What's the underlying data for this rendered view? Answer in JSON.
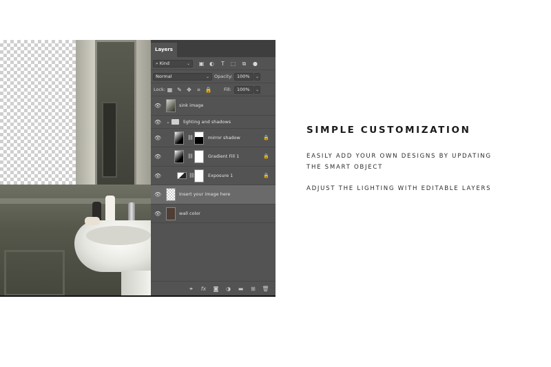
{
  "panel": {
    "tab_label": "Layers",
    "filter": {
      "kind_label": "Kind",
      "caret": "⌄"
    },
    "blend": {
      "mode": "Normal",
      "opacity_label": "Opacity:",
      "opacity_value": "100%"
    },
    "lock": {
      "lock_label": "Lock:",
      "fill_label": "Fill:",
      "fill_value": "100%"
    },
    "layers": [
      {
        "name": "sink image"
      },
      {
        "name": "lighting and shadows"
      },
      {
        "name": "mirror shadow"
      },
      {
        "name": "Gradient Fill 1"
      },
      {
        "name": "Exposure 1"
      },
      {
        "name": "Insert your image here"
      },
      {
        "name": "wall color"
      }
    ],
    "footer_fx": "fx"
  },
  "marketing": {
    "headline": "SIMPLE CUSTOMIZATION",
    "line1": "EASILY ADD YOUR OWN DESIGNS BY UPDATING",
    "line2": "THE SMART OBJECT",
    "line3": "ADJUST THE LIGHTING WITH EDITABLE LAYERS"
  }
}
